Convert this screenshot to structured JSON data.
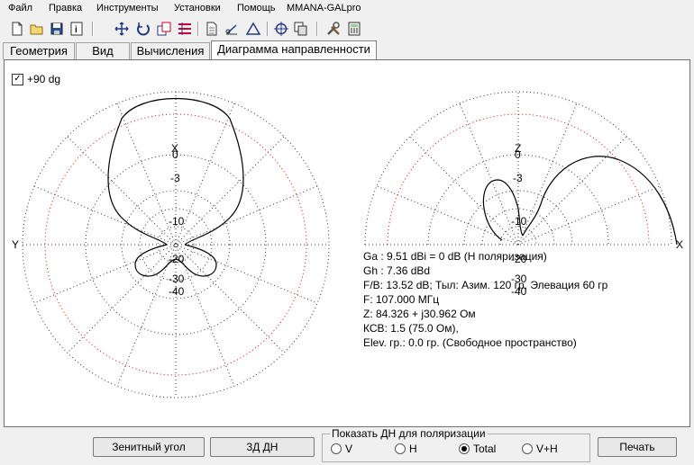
{
  "menu": [
    "Файл",
    "Правка",
    "Инструменты",
    "Установки",
    "Помощь",
    "MMANA-GALpro"
  ],
  "toolbar_icons": [
    "new-file-icon",
    "open-folder-icon",
    "save-icon",
    "info-icon",
    "move-icon",
    "rotate-icon",
    "copy-icon",
    "list-icon",
    "doc-icon",
    "measure-icon",
    "triangle-icon",
    "target-icon",
    "duplicate-icon",
    "tools-icon",
    "calculator-icon"
  ],
  "tabs": [
    "Геометрия",
    "Вид",
    "Вычисления",
    "Диаграмма направленности"
  ],
  "checkbox_label": "+90 dg",
  "left_plot": {
    "top_label": "X",
    "left_label": "Y",
    "ring_labels": [
      "0",
      "-3",
      "-10",
      "-20",
      "-30",
      "-40"
    ]
  },
  "right_plot": {
    "top_label": "Z",
    "right_label": "X",
    "ring_labels": [
      "0",
      "-3",
      "-10",
      "-20",
      "-30",
      "-40"
    ]
  },
  "info_lines": [
    "Ga : 9.51 dBi = 0 dB  (Н поляризация)",
    "Gh : 7.36 dBd",
    "F/B: 13.52 dB; Тыл: Азим. 120 гр, Элевация 60 гр",
    "F: 107.000 МГц",
    "Z: 84.326 + j30.962 Ом",
    "КСВ: 1.5 (75.0 Ом),",
    "Elev. гр.: 0.0 гр. (Свободное пространство)"
  ],
  "buttons": {
    "zenith": "Зенитный угол",
    "three_d": "3Д   ДН",
    "print": "Печать"
  },
  "polarization": {
    "title": "Показать ДН для поляризации",
    "options": [
      "V",
      "H",
      "Total",
      "V+H"
    ],
    "selected": "Total"
  }
}
